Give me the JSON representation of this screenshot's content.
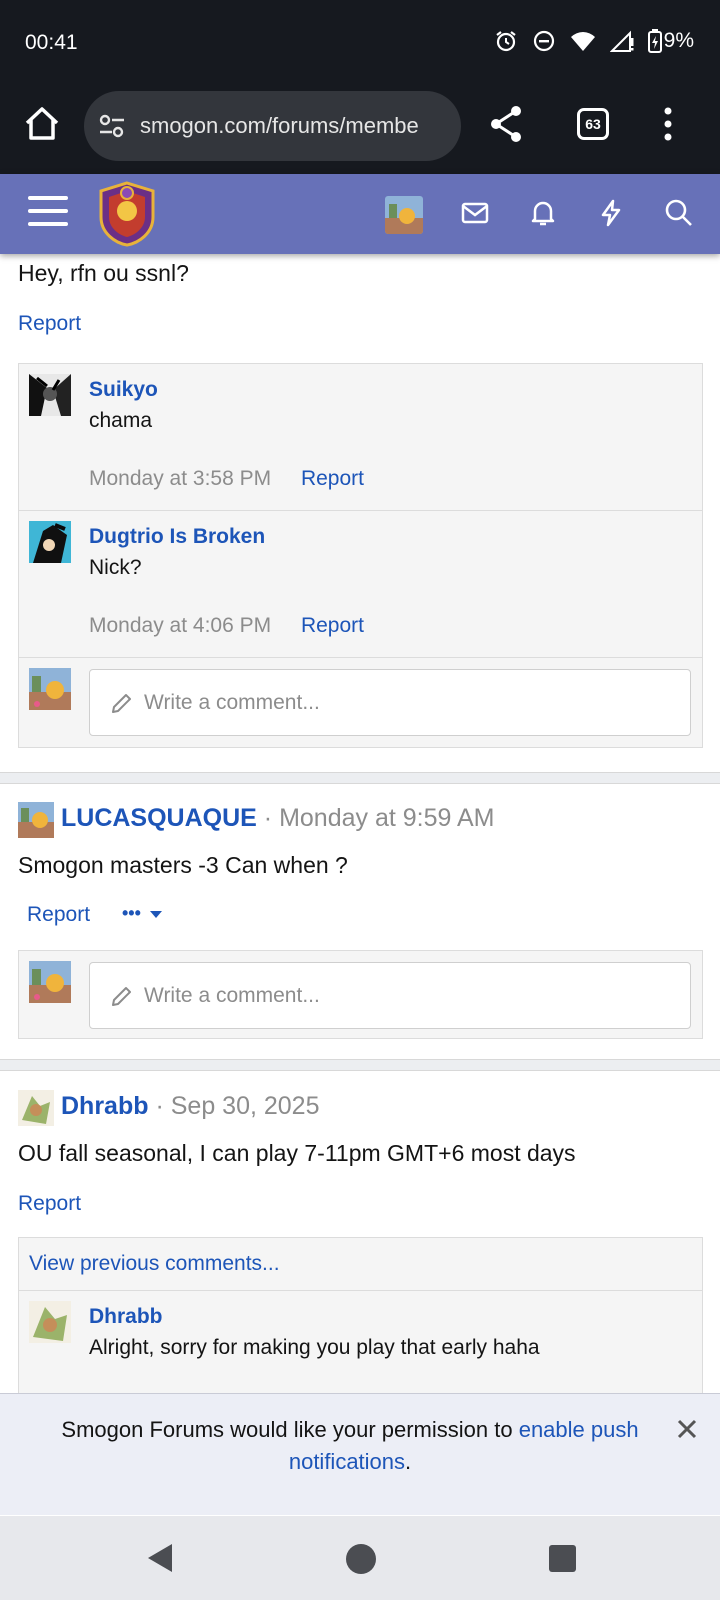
{
  "status": {
    "time": "00:41",
    "battery": "9%"
  },
  "browser": {
    "url": "smogon.com/forums/membe",
    "tab_count": "63"
  },
  "feed": {
    "partial_post": {
      "text": "Hey, rfn ou ssnl?",
      "report": "Report",
      "comments": [
        {
          "author": "Suikyo",
          "text": "chama",
          "time": "Monday at 3:58 PM",
          "report": "Report"
        },
        {
          "author": "Dugtrio Is Broken",
          "text": "Nick?",
          "time": "Monday at 4:06 PM",
          "report": "Report"
        }
      ],
      "write_placeholder": "Write a comment..."
    },
    "post2": {
      "author": "LUCASQUAQUE",
      "separator": "·",
      "time": "Monday at 9:59 AM",
      "text": "Smogon masters -3 Can when ?",
      "report": "Report",
      "more": "•••",
      "write_placeholder": "Write a comment..."
    },
    "post3": {
      "author": "Dhrabb",
      "separator": "·",
      "time": "Sep 30, 2025",
      "text": "OU fall seasonal, I can play 7-11pm GMT+6 most days",
      "report": "Report",
      "view_previous": "View previous comments...",
      "comments": [
        {
          "author": "Dhrabb",
          "text": "Alright, sorry for making you play that early haha"
        }
      ]
    }
  },
  "push_banner": {
    "text_before": "Smogon Forums would like your permission to ",
    "link": "enable push notifications",
    "text_after": "."
  },
  "colors": {
    "header": "#6771b8",
    "link": "#1d55b8",
    "statusbar": "#16191f"
  }
}
